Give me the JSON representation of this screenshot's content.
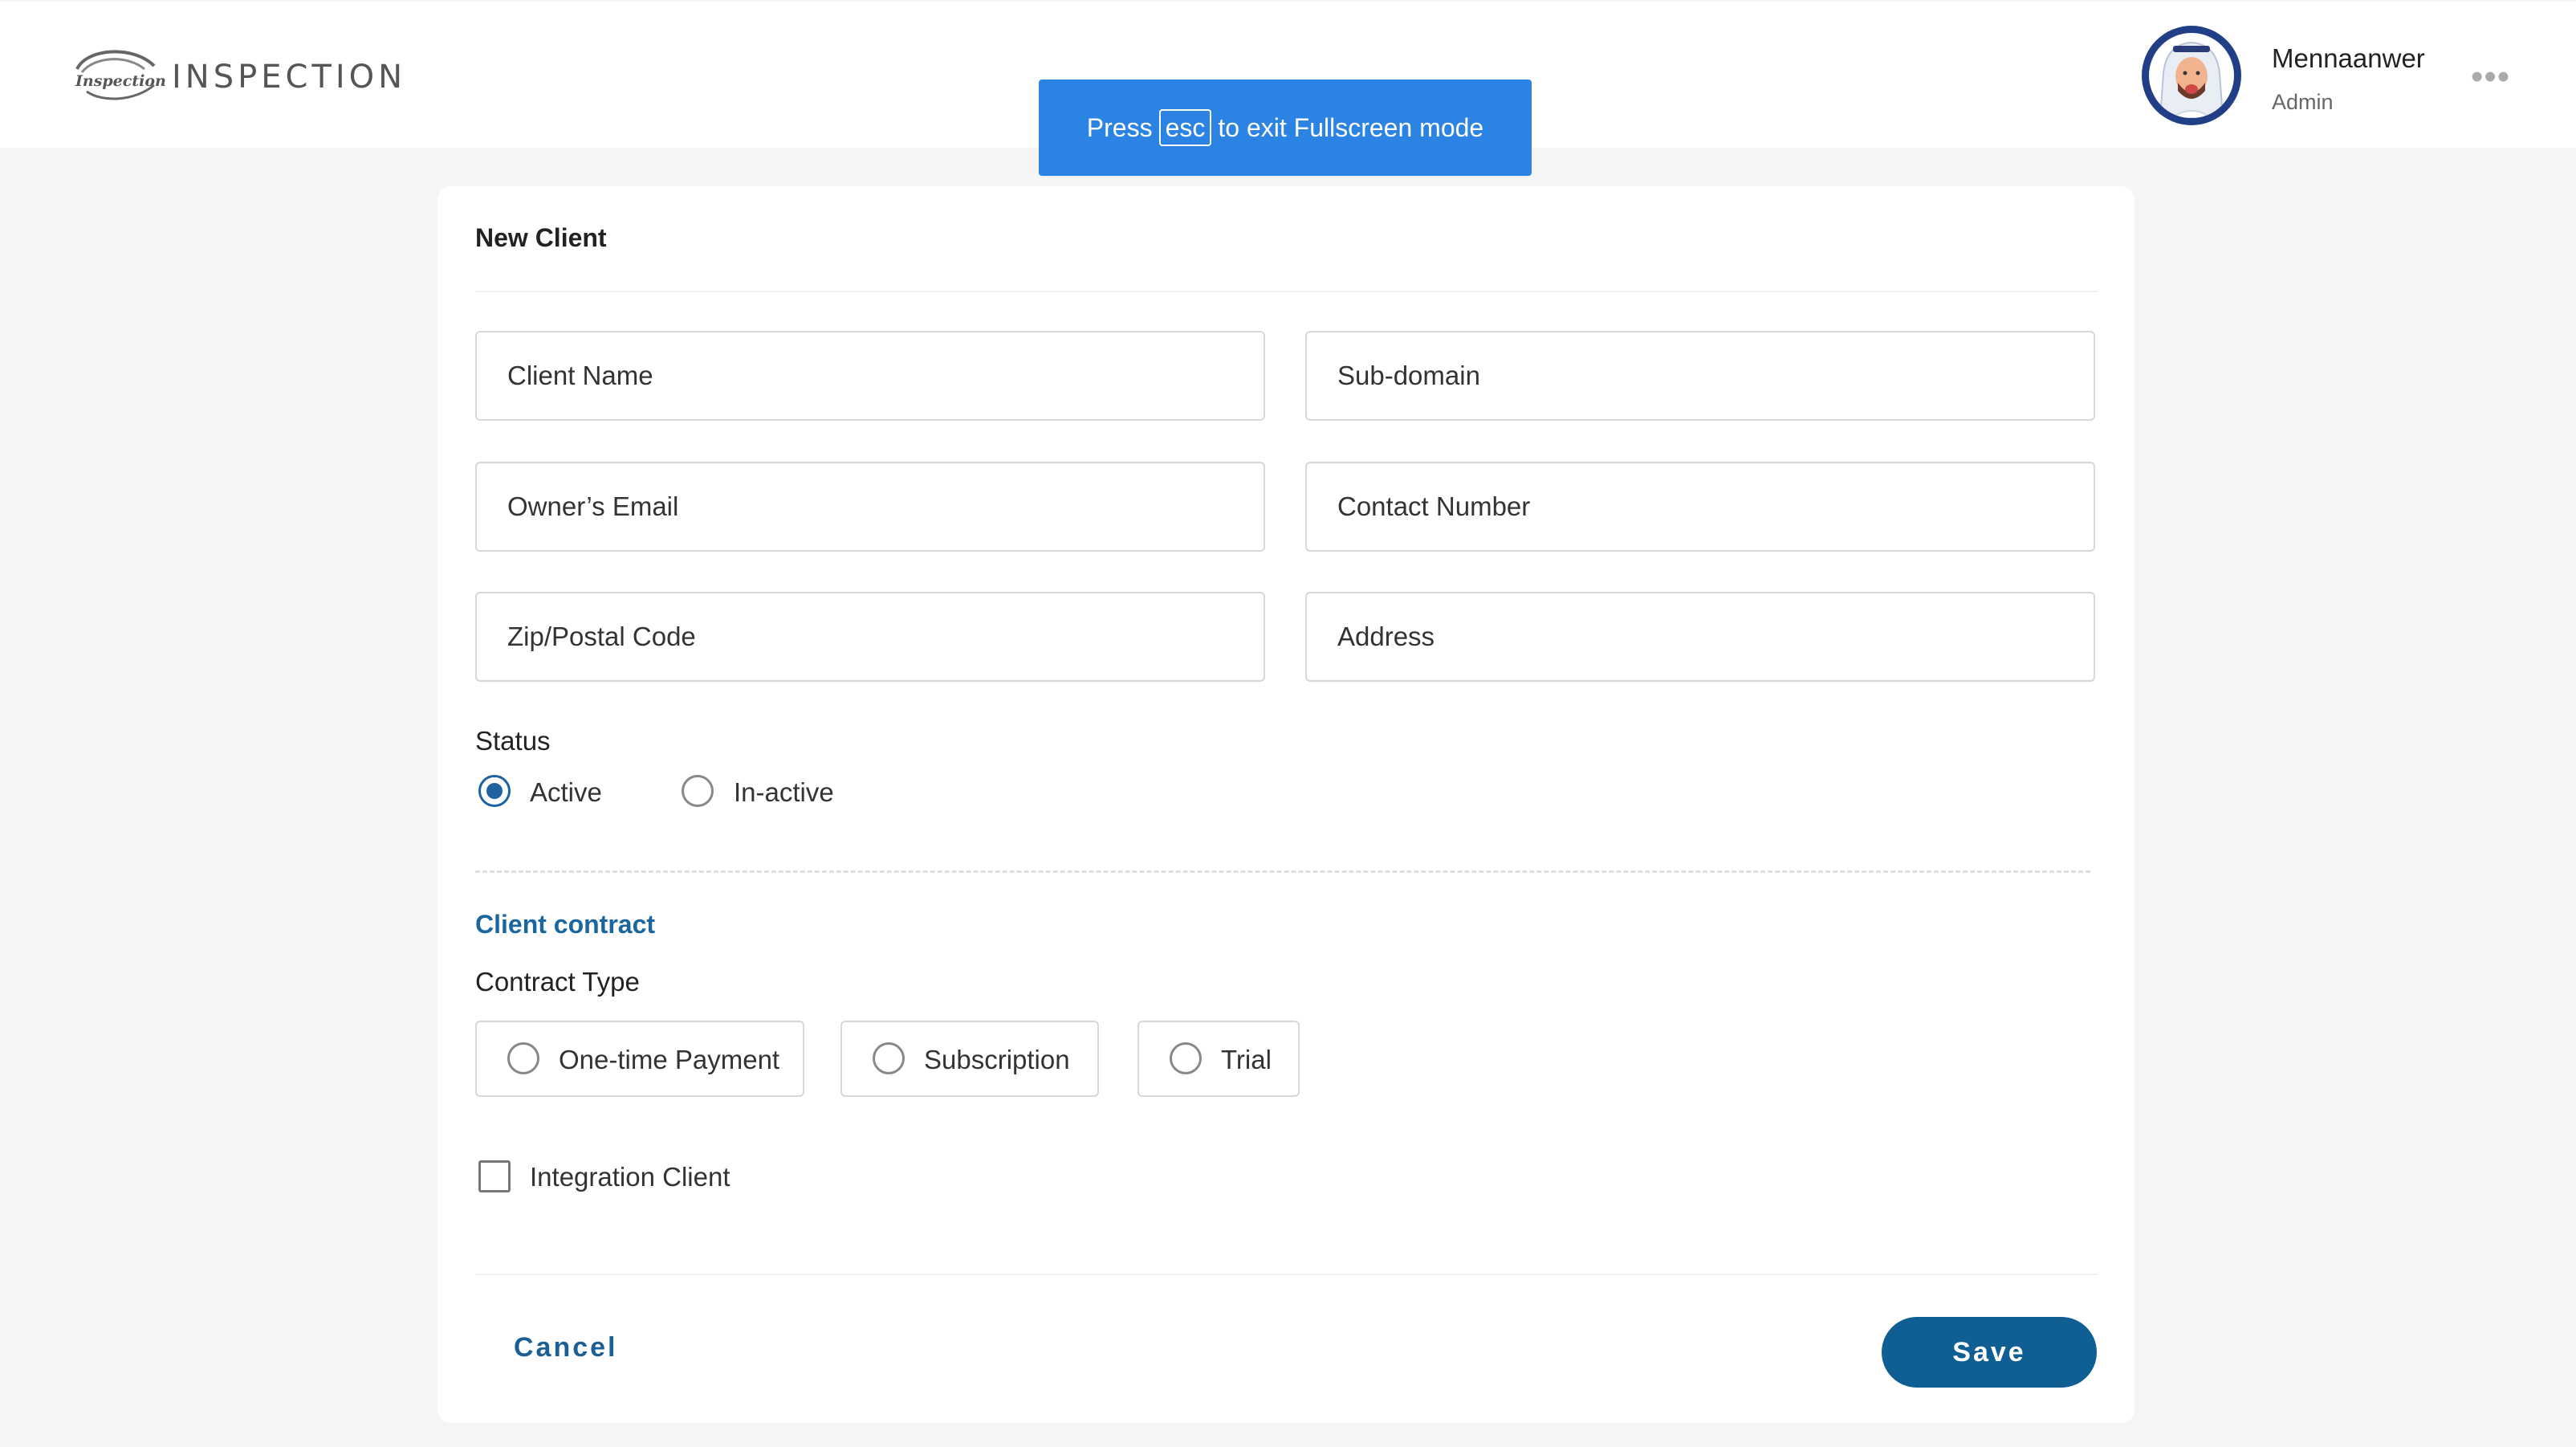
{
  "header": {
    "logo_small_text": "Inspection",
    "logo_text": "INSPECTION",
    "user": {
      "name": "Mennaanwer",
      "role": "Admin"
    },
    "more_label": "•••"
  },
  "fullscreen_notice": {
    "prefix": "Press",
    "key": "esc",
    "suffix": "to exit Fullscreen mode"
  },
  "form": {
    "title": "New Client",
    "fields": {
      "client_name": {
        "placeholder": "Client Name",
        "value": ""
      },
      "sub_domain": {
        "placeholder": "Sub-domain",
        "value": ""
      },
      "owner_email": {
        "placeholder": "Owner’s Email",
        "value": ""
      },
      "contact_number": {
        "placeholder": "Contact Number",
        "value": ""
      },
      "zip_code": {
        "placeholder": "Zip/Postal Code",
        "value": ""
      },
      "address": {
        "placeholder": "Address",
        "value": ""
      }
    },
    "status": {
      "label": "Status",
      "options": [
        {
          "label": "Active",
          "checked": true
        },
        {
          "label": "In-active",
          "checked": false
        }
      ]
    },
    "contract": {
      "section_title": "Client contract",
      "type_label": "Contract Type",
      "options": [
        {
          "label": "One-time Payment",
          "checked": false
        },
        {
          "label": "Subscription",
          "checked": false
        },
        {
          "label": "Trial",
          "checked": false
        }
      ]
    },
    "integration_client": {
      "label": "Integration Client",
      "checked": false
    },
    "actions": {
      "cancel_label": "Cancel",
      "save_label": "Save"
    }
  },
  "colors": {
    "accent": "#0f5e94",
    "section_title": "#1a66a0",
    "toast_bg": "#2b83e4",
    "avatar_ring": "#213f86",
    "page_bg": "#f5f5f5"
  }
}
